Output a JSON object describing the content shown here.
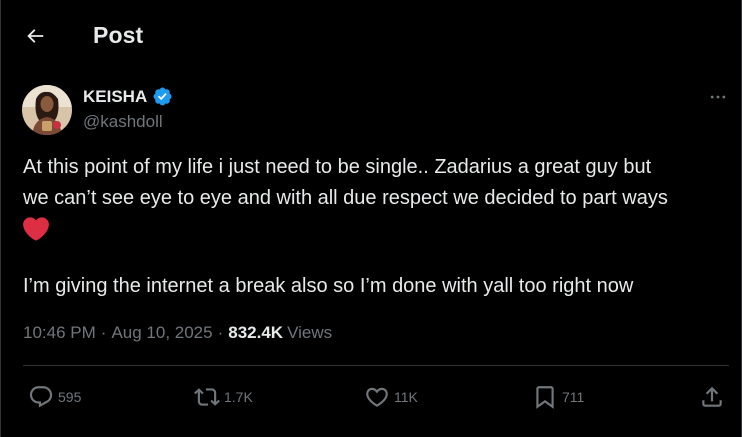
{
  "header": {
    "title": "Post",
    "back_icon": "arrow-left-icon"
  },
  "author": {
    "name": "KEISHA",
    "handle": "@kashdoll",
    "verified_color": "#1d9bf0"
  },
  "tweet": {
    "line1": "At this point of my life i just need to be single.. Zadarius a great guy but",
    "line2": "we can’t see eye to eye and with all due respect we decided to part ways",
    "heart_emoji": "red-heart-emoji",
    "line3": "I’m giving the internet a break also so I’m done with yall too right now"
  },
  "meta": {
    "time": "10:46 PM",
    "separator": "·",
    "date": "Aug 10, 2025",
    "views_count": "832.4K",
    "views_label": "Views"
  },
  "actions": {
    "replies": "595",
    "reposts": "1.7K",
    "likes": "11K",
    "bookmarks": "711"
  },
  "colors": {
    "background": "#000000",
    "text": "#e7e9ea",
    "muted": "#71767b",
    "divider": "#2f3336",
    "heart": "#f91880"
  }
}
